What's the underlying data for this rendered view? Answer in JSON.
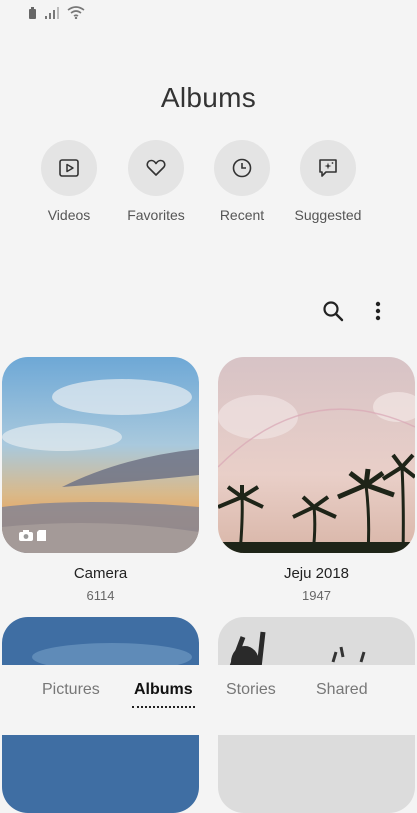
{
  "header": {
    "title": "Albums"
  },
  "quick_access": [
    {
      "label": "Videos",
      "icon": "video-icon"
    },
    {
      "label": "Favorites",
      "icon": "heart-icon"
    },
    {
      "label": "Recent",
      "icon": "clock-icon"
    },
    {
      "label": "Suggested",
      "icon": "suggested-icon"
    }
  ],
  "toolbar": {
    "search_icon": "search-icon",
    "more_icon": "more-options-icon"
  },
  "albums": [
    {
      "name": "Camera",
      "count": "6114"
    },
    {
      "name": "Jeju 2018",
      "count": "1947"
    }
  ],
  "bottom_nav": {
    "tabs": [
      "Pictures",
      "Albums",
      "Stories",
      "Shared"
    ],
    "active": "Albums"
  }
}
